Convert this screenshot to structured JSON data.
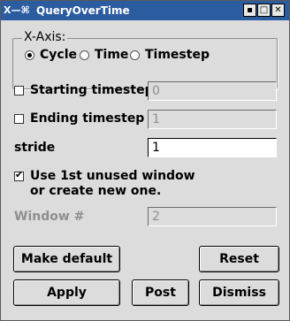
{
  "window": {
    "title": "QueryOverTime",
    "sysmenu": "X—⌘",
    "buttons": {
      "minimize": "▪",
      "maximize": "□",
      "close": "✕"
    }
  },
  "xaxis": {
    "title": "X-Axis:",
    "options": [
      {
        "label": "Cycle",
        "selected": true
      },
      {
        "label": "Time",
        "selected": false
      },
      {
        "label": "Timestep",
        "selected": false
      }
    ]
  },
  "starting_timestep": {
    "label": "Starting timestep",
    "checked": false,
    "value": "0"
  },
  "ending_timestep": {
    "label": "Ending timestep",
    "checked": false,
    "value": "1"
  },
  "stride": {
    "label": "stride",
    "value": "1"
  },
  "use_window": {
    "label_line1": "Use 1st unused window",
    "label_line2": "or create new one.",
    "checked": true
  },
  "window_num": {
    "label": "Window #",
    "value": "2"
  },
  "buttons": {
    "make_default": "Make default",
    "reset": "Reset",
    "apply": "Apply",
    "post": "Post",
    "dismiss": "Dismiss"
  }
}
